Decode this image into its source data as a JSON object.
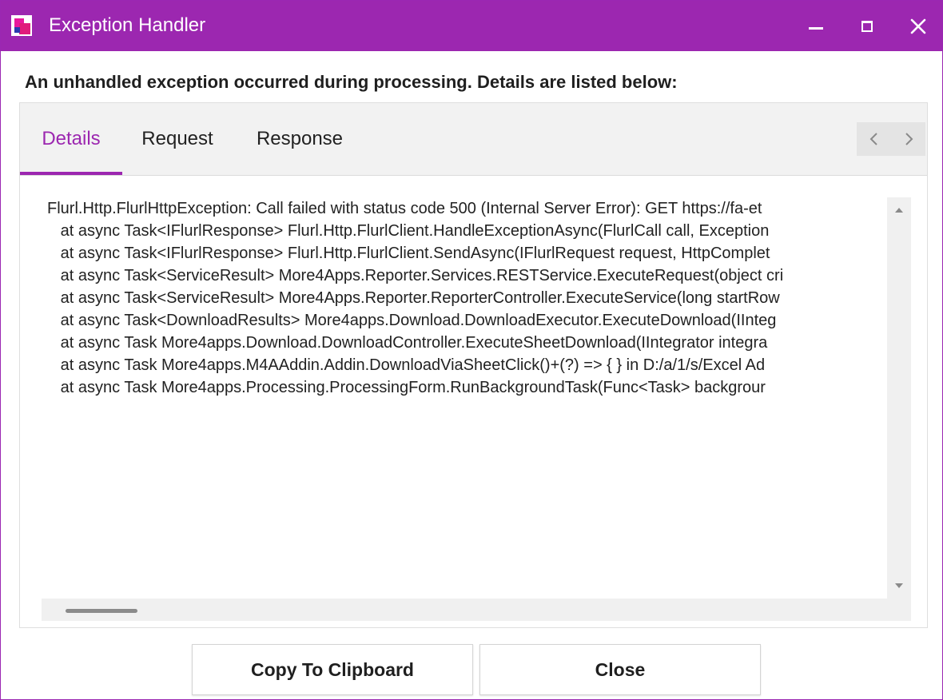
{
  "window": {
    "title": "Exception Handler",
    "accent_color": "#9c27b0",
    "icons": [
      "app-icon",
      "minimize-icon",
      "maximize-icon",
      "close-icon"
    ]
  },
  "message": "An unhandled exception occurred during processing. Details are listed below:",
  "tabs": [
    {
      "label": "Details",
      "active": true
    },
    {
      "label": "Request",
      "active": false
    },
    {
      "label": "Response",
      "active": false
    }
  ],
  "details_lines": [
    "Flurl.Http.FlurlHttpException: Call failed with status code 500 (Internal Server Error): GET https://fa-et",
    "   at async Task<IFlurlResponse> Flurl.Http.FlurlClient.HandleExceptionAsync(FlurlCall call, Exception",
    "   at async Task<IFlurlResponse> Flurl.Http.FlurlClient.SendAsync(IFlurlRequest request, HttpComplet",
    "   at async Task<ServiceResult> More4Apps.Reporter.Services.RESTService.ExecuteRequest(object cri",
    "   at async Task<ServiceResult> More4Apps.Reporter.ReporterController.ExecuteService(long startRow",
    "   at async Task<DownloadResults> More4apps.Download.DownloadExecutor.ExecuteDownload(IInteg",
    "   at async Task More4apps.Download.DownloadController.ExecuteSheetDownload(IIntegrator integra",
    "   at async Task More4apps.M4AAddin.Addin.DownloadViaSheetClick()+(?) => { } in D:/a/1/s/Excel Ad",
    "   at async Task More4apps.Processing.ProcessingForm.RunBackgroundTask(Func<Task> backgrour"
  ],
  "buttons": {
    "copy": "Copy To Clipboard",
    "close": "Close"
  }
}
